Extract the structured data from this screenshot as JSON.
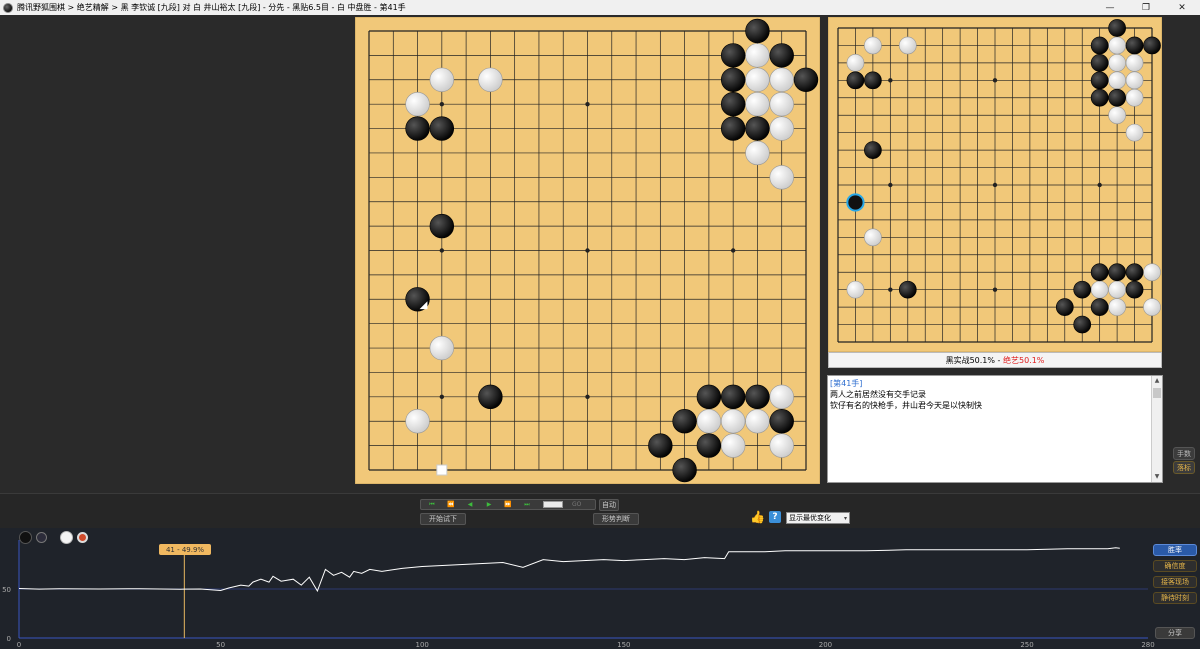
{
  "window": {
    "title": "腾讯野狐围棋 > 绝艺精解 > 黑 李钦诚 [九段] 对 白 井山裕太 [九段] - 分先 - 黑贴6.5目 - 白 中盘胜 - 第41手",
    "minimize": "—",
    "maximize": "❐",
    "close": "✕"
  },
  "main_board": {
    "size": 19,
    "hoshi": [
      [
        3,
        3
      ],
      [
        3,
        9
      ],
      [
        3,
        15
      ],
      [
        9,
        3
      ],
      [
        9,
        9
      ],
      [
        9,
        15
      ],
      [
        15,
        3
      ],
      [
        15,
        9
      ],
      [
        15,
        15
      ]
    ],
    "black": [
      [
        16,
        0
      ],
      [
        15,
        1
      ],
      [
        17,
        1
      ],
      [
        15,
        2
      ],
      [
        18,
        2
      ],
      [
        15,
        3
      ],
      [
        15,
        4
      ],
      [
        16,
        4
      ],
      [
        2,
        4
      ],
      [
        3,
        4
      ],
      [
        3,
        8
      ],
      [
        5,
        15
      ],
      [
        14,
        15
      ],
      [
        15,
        15
      ],
      [
        16,
        15
      ],
      [
        13,
        16
      ],
      [
        17,
        16
      ],
      [
        12,
        17
      ],
      [
        14,
        17
      ],
      [
        13,
        18
      ]
    ],
    "white": [
      [
        3,
        2
      ],
      [
        5,
        2
      ],
      [
        16,
        1
      ],
      [
        16,
        2
      ],
      [
        17,
        2
      ],
      [
        16,
        3
      ],
      [
        17,
        3
      ],
      [
        17,
        4
      ],
      [
        16,
        5
      ],
      [
        17,
        6
      ],
      [
        2,
        3
      ],
      [
        3,
        13
      ],
      [
        2,
        16
      ],
      [
        17,
        15
      ],
      [
        14,
        16
      ],
      [
        15,
        16
      ],
      [
        16,
        16
      ],
      [
        15,
        17
      ],
      [
        17,
        17
      ]
    ],
    "last_move": [
      2,
      11
    ],
    "square_marker": [
      3,
      18
    ]
  },
  "ai_board": {
    "size": 19,
    "hoshi": [
      [
        3,
        3
      ],
      [
        3,
        9
      ],
      [
        3,
        15
      ],
      [
        9,
        3
      ],
      [
        9,
        9
      ],
      [
        9,
        15
      ],
      [
        15,
        3
      ],
      [
        15,
        9
      ],
      [
        15,
        15
      ]
    ],
    "black": [
      [
        16,
        0
      ],
      [
        15,
        1
      ],
      [
        17,
        1
      ],
      [
        15,
        2
      ],
      [
        18,
        1
      ],
      [
        15,
        3
      ],
      [
        15,
        4
      ],
      [
        16,
        4
      ],
      [
        1,
        3
      ],
      [
        2,
        3
      ],
      [
        2,
        7
      ],
      [
        4,
        15
      ],
      [
        15,
        14
      ],
      [
        16,
        14
      ],
      [
        17,
        14
      ],
      [
        14,
        15
      ],
      [
        17,
        15
      ],
      [
        13,
        16
      ],
      [
        15,
        16
      ],
      [
        14,
        17
      ]
    ],
    "white": [
      [
        2,
        1
      ],
      [
        4,
        1
      ],
      [
        16,
        1
      ],
      [
        16,
        2
      ],
      [
        17,
        2
      ],
      [
        16,
        3
      ],
      [
        17,
        3
      ],
      [
        17,
        4
      ],
      [
        16,
        5
      ],
      [
        17,
        6
      ],
      [
        1,
        2
      ],
      [
        2,
        12
      ],
      [
        1,
        15
      ],
      [
        18,
        14
      ],
      [
        15,
        15
      ],
      [
        16,
        15
      ],
      [
        18,
        16
      ],
      [
        16,
        16
      ]
    ],
    "highlight": [
      1,
      10
    ]
  },
  "status": {
    "black_text": "黑实战50.1%",
    "sep": " - ",
    "ai_text": "绝艺50.1%"
  },
  "comment": {
    "move_tag": "[第41手]",
    "line1": "两人之前居然没有交手记录",
    "line2": "钦仔有名的快枪手，井山君今天是以快制快",
    "scroll_up": "▲",
    "scroll_down": "▼"
  },
  "side_buttons": {
    "moves": "手数",
    "stones": "落标"
  },
  "controls": {
    "nav": [
      "⏮",
      "⏪",
      "◀",
      "▶",
      "⏩",
      "⏭"
    ],
    "go": "GO",
    "auto": "自动",
    "try": "开始试下",
    "judge": "形势判断",
    "thumb": "👍",
    "help": "?",
    "variation": "显示最优变化",
    "variation_arrow": "▾"
  },
  "graph": {
    "y_ticks": [
      "0",
      "50"
    ],
    "x_ticks": [
      "0",
      "50",
      "100",
      "150",
      "200",
      "250",
      "280"
    ],
    "marker_label": "41 - 49.9%",
    "buttons": [
      "胜率",
      "确信度",
      "接客现场",
      "静待时刻"
    ],
    "share": "分享",
    "colors": {
      "line": "#ffffff",
      "marker": "#e8b860",
      "axis": "#3a56c0"
    }
  },
  "chart_data": {
    "type": "line",
    "title": "",
    "xlabel": "",
    "ylabel": "",
    "xlim": [
      0,
      280
    ],
    "ylim": [
      0,
      100
    ],
    "x_ticks": [
      0,
      50,
      100,
      150,
      200,
      250,
      280
    ],
    "y_ticks": [
      0,
      50
    ],
    "x": [
      0,
      5,
      10,
      20,
      30,
      40,
      41,
      45,
      50,
      52,
      55,
      57,
      58,
      60,
      62,
      63,
      65,
      68,
      70,
      72,
      74,
      76,
      78,
      80,
      82,
      83,
      85,
      87,
      90,
      95,
      100,
      105,
      110,
      115,
      120,
      125,
      130,
      135,
      140,
      145,
      150,
      155,
      160,
      165,
      170,
      175,
      176,
      180,
      185,
      190,
      195,
      200,
      210,
      220,
      230,
      240,
      250,
      260,
      270,
      272,
      273
    ],
    "values": [
      50.5,
      49.9,
      50.2,
      50.0,
      50.3,
      49.8,
      49.9,
      50.0,
      48.5,
      51,
      54,
      53,
      57,
      60,
      57,
      63,
      58,
      60,
      54,
      62,
      48,
      70,
      64,
      67,
      62,
      68,
      66,
      70,
      68,
      71,
      73,
      74,
      75,
      76,
      77,
      72,
      80,
      78,
      79,
      80,
      79,
      80,
      81,
      80,
      82,
      81,
      88,
      88,
      88,
      89,
      89,
      89,
      89,
      90,
      90,
      90,
      90,
      91,
      91,
      92,
      91.5
    ],
    "marker_x": 41,
    "marker_value": 49.9
  }
}
